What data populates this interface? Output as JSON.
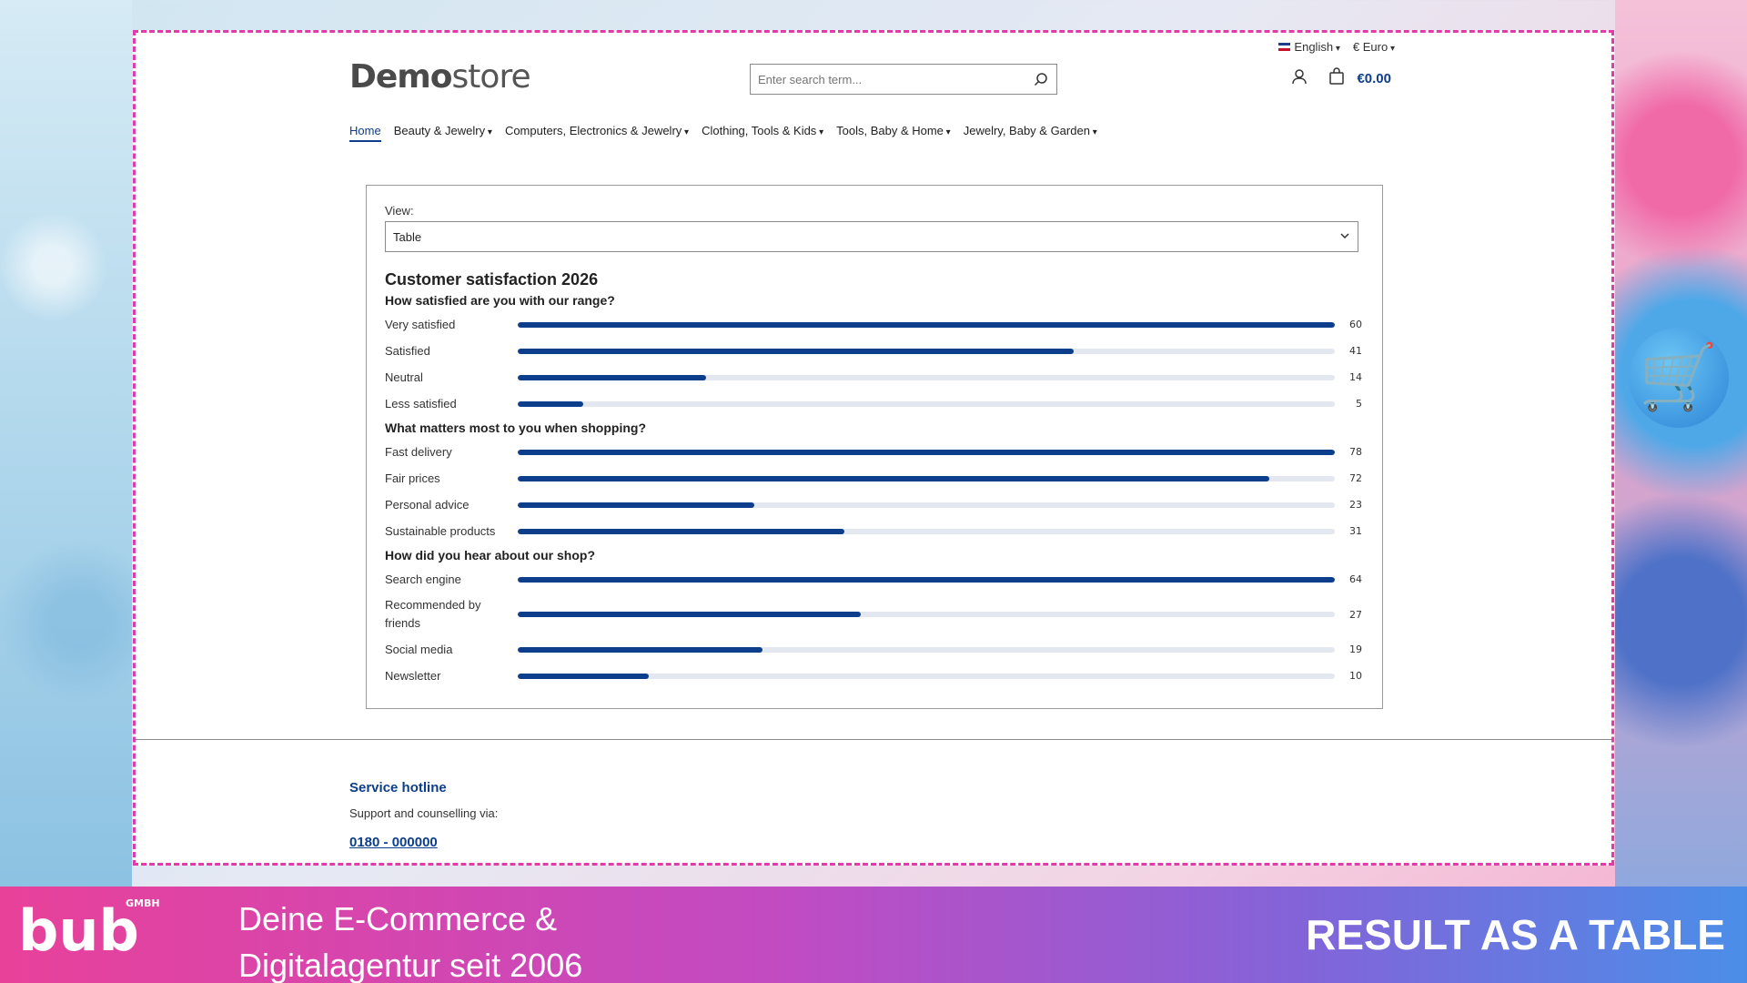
{
  "topbar": {
    "language": "English",
    "currency": "€ Euro"
  },
  "header": {
    "logo_bold": "Demo",
    "logo_light": "store",
    "search_placeholder": "Enter search term...",
    "cart_total": "€0.00"
  },
  "nav": {
    "items": [
      {
        "label": "Home"
      },
      {
        "label": "Beauty & Jewelry"
      },
      {
        "label": "Computers, Electronics & Jewelry"
      },
      {
        "label": "Clothing, Tools & Kids"
      },
      {
        "label": "Tools, Baby & Home"
      },
      {
        "label": "Jewelry, Baby & Garden"
      }
    ]
  },
  "survey": {
    "view_label": "View:",
    "view_value": "Table",
    "title": "Customer satisfaction 2026",
    "questions": [
      {
        "question": "How satisfied are you with our range?",
        "answers": [
          {
            "label": "Very satisfied",
            "value": 60,
            "fill": 1.0
          },
          {
            "label": "Satisfied",
            "value": 41,
            "fill": 0.68
          },
          {
            "label": "Neutral",
            "value": 14,
            "fill": 0.23
          },
          {
            "label": "Less satisfied",
            "value": 5,
            "fill": 0.08
          }
        ]
      },
      {
        "question": "What matters most to you when shopping?",
        "answers": [
          {
            "label": "Fast delivery",
            "value": 78,
            "fill": 1.0
          },
          {
            "label": "Fair prices",
            "value": 72,
            "fill": 0.92
          },
          {
            "label": "Personal advice",
            "value": 23,
            "fill": 0.29
          },
          {
            "label": "Sustainable products",
            "value": 31,
            "fill": 0.4
          }
        ]
      },
      {
        "question": "How did you hear about our shop?",
        "answers": [
          {
            "label": "Search engine",
            "value": 64,
            "fill": 1.0
          },
          {
            "label": "Recommended by friends",
            "value": 27,
            "fill": 0.42
          },
          {
            "label": "Social media",
            "value": 19,
            "fill": 0.3
          },
          {
            "label": "Newsletter",
            "value": 10,
            "fill": 0.16
          }
        ]
      }
    ]
  },
  "footer": {
    "title": "Service hotline",
    "text": "Support and counselling via:",
    "phone": "0180 - 000000"
  },
  "banner": {
    "brand": "bub",
    "brand_sub": "GMBH",
    "tagline_1": "Deine E-Commerce &",
    "tagline_2": "Digitalagentur seit 2006",
    "result": "RESULT AS A TABLE"
  },
  "colors": {
    "accent": "#0d3e8c",
    "frame_border": "#e23aa8",
    "track": "#e3e8f0"
  }
}
